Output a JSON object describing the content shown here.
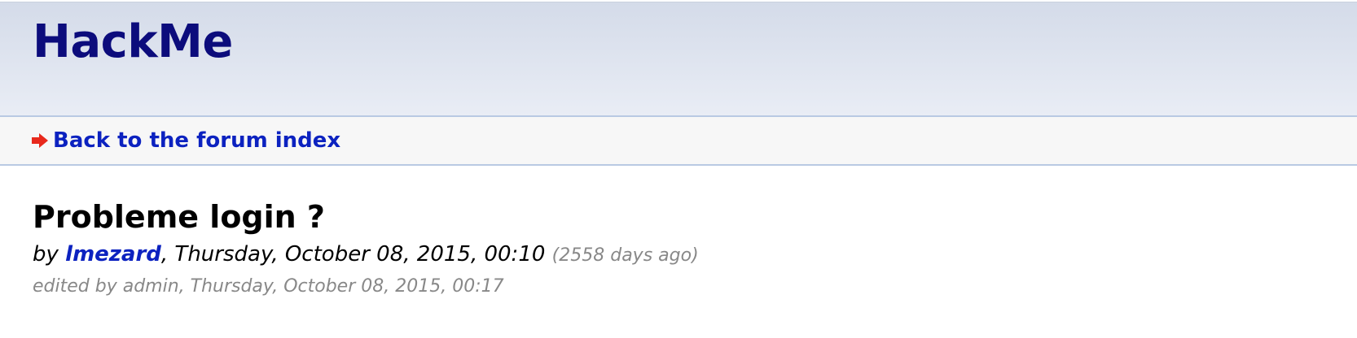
{
  "header": {
    "site_title": "HackMe"
  },
  "nav": {
    "back_label": "Back to the forum index",
    "icon": "right-arrow-icon",
    "icon_color": "#e8291c"
  },
  "post": {
    "title": "Probleme login ?",
    "by_prefix": "by ",
    "author": "lmezard",
    "date": ", Thursday, October 08, 2015, 00:10",
    "ago": "(2558 days ago)",
    "edited": "edited by admin, Thursday, October 08, 2015, 00:17"
  },
  "colors": {
    "title_blue": "#0c0c7c",
    "link_blue": "#0c22c0",
    "muted_gray": "#888888"
  }
}
